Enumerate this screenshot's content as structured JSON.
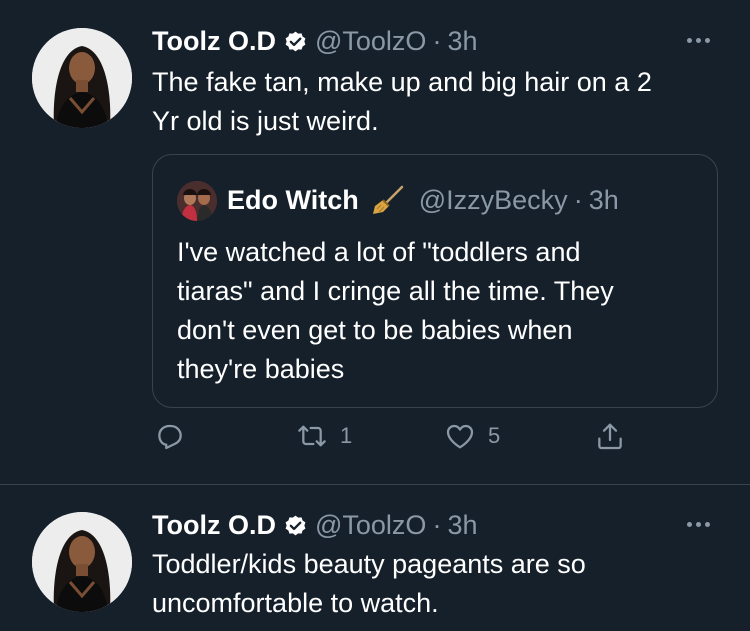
{
  "tweets": [
    {
      "author": {
        "name": "Toolz O.D",
        "handle": "@ToolzO",
        "verified": true
      },
      "separator": "·",
      "time": "3h",
      "text_lines": [
        "The fake tan, make up and big hair on a 2",
        "Yr old is just weird."
      ],
      "quote": {
        "author": {
          "name": "Edo Witch",
          "name_emoji": "broom-icon",
          "handle": "@IzzyBecky"
        },
        "separator": "·",
        "time": "3h",
        "text_lines": [
          "I've watched a lot of \"toddlers and",
          "tiaras\" and I cringe all the time. They",
          "don't even get to be babies when",
          "they're babies"
        ]
      },
      "actions": {
        "reply_count": "",
        "retweet_count": "1",
        "like_count": "5"
      }
    },
    {
      "author": {
        "name": "Toolz O.D",
        "handle": "@ToolzO",
        "verified": true
      },
      "separator": "·",
      "time": "3h",
      "text_lines": [
        "Toddler/kids beauty pageants are so",
        "uncomfortable to watch."
      ]
    }
  ],
  "colors": {
    "background": "#15202b",
    "text_primary": "#ffffff",
    "text_secondary": "#8b98a5",
    "border": "#38444d",
    "verified_badge": "#ffffff"
  }
}
